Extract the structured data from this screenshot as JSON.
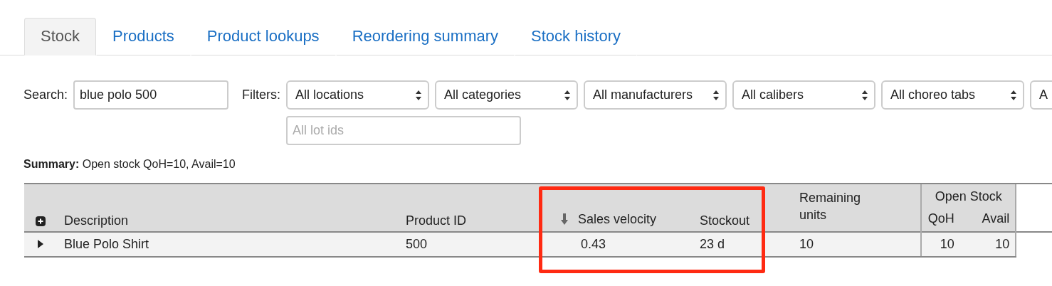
{
  "tabs": [
    {
      "label": "Stock",
      "selected": true
    },
    {
      "label": "Products",
      "selected": false
    },
    {
      "label": "Product lookups",
      "selected": false
    },
    {
      "label": "Reordering summary",
      "selected": false
    },
    {
      "label": "Stock history",
      "selected": false
    }
  ],
  "search": {
    "label": "Search:",
    "value": "blue polo 500"
  },
  "filters": {
    "label": "Filters:",
    "selects": [
      "All locations",
      "All categories",
      "All manufacturers",
      "All calibers",
      "All choreo tabs",
      "A"
    ],
    "lot_ids": {
      "placeholder": "All lot ids"
    }
  },
  "summary": {
    "label": "Summary:",
    "text": "Open stock QoH=10, Avail=10"
  },
  "table": {
    "columns": [
      {
        "label": "Description"
      },
      {
        "label": "Product ID"
      },
      {
        "label": "Sales velocity",
        "sorted": true
      },
      {
        "label": "Stockout"
      },
      {
        "label": "Remaining units"
      }
    ],
    "group": {
      "label": "Open Stock",
      "columns": [
        {
          "label": "QoH"
        },
        {
          "label": "Avail"
        }
      ]
    },
    "rows": [
      {
        "expanded": false,
        "cells": [
          "Blue Polo Shirt",
          "500",
          "0.43",
          "23 d",
          "10",
          "10",
          "10"
        ]
      }
    ]
  },
  "annotations": [
    {
      "kind": "rectangle",
      "color": "#ff2a12"
    }
  ]
}
